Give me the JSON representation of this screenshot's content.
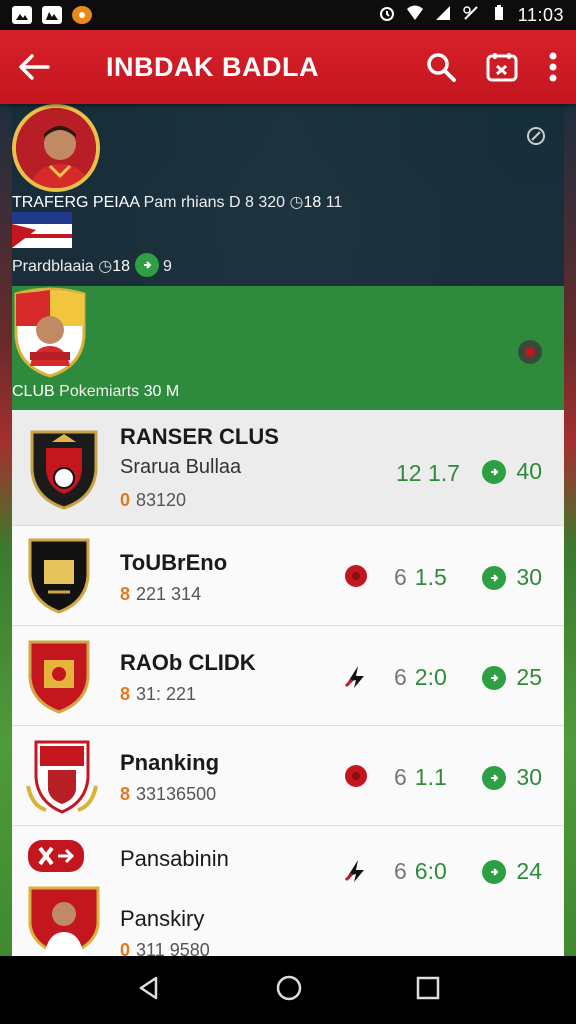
{
  "status_bar": {
    "time": "11:03",
    "left_icons": [
      "photo-icon",
      "image-icon",
      "notification-icon"
    ],
    "right_icons": [
      "alarm-icon",
      "wifi-icon",
      "signal-icon",
      "data-icon",
      "battery-icon"
    ]
  },
  "app_bar": {
    "title": "INBDAK BADLA",
    "back_icon": "back-arrow-icon",
    "actions": [
      "search-icon",
      "calendar-icon",
      "more-vert-icon"
    ]
  },
  "header_card": {
    "title": "TRAFERG PEIAA",
    "subtitle": "Pam rhians",
    "meta": "D 8 320",
    "score": "18",
    "right_value": "11",
    "second_line": {
      "name": "Prardblaaia",
      "score": "18",
      "right_value": "9"
    }
  },
  "highlight_card": {
    "title": "CLUB",
    "subtitle": "Pokemiarts",
    "score": "30 M"
  },
  "rows": [
    {
      "name": "RANSER CLUS",
      "sub": "Srarua Bullaa",
      "meta_num": "0",
      "meta": "83120",
      "score": "12 1.7",
      "right": "40"
    },
    {
      "name": "ToUBrEno",
      "sub": "",
      "meta_num": "8",
      "meta": "221 314",
      "score": "1.5",
      "right": "30"
    },
    {
      "name": "RAOb CLIDK",
      "sub": "",
      "meta_num": "8",
      "meta": "31: 221",
      "score": "2:0",
      "right": "25"
    },
    {
      "name": "Pnanking",
      "sub": "",
      "meta_num": "8",
      "meta": "33136500",
      "score": "1.1",
      "right": "30"
    },
    {
      "name": "Pansabinin",
      "sub": "",
      "meta_num": "",
      "meta": "",
      "score": "6:0",
      "right": "24"
    },
    {
      "name": "Panskiry",
      "sub": "",
      "meta_num": "0",
      "meta": "311 9580",
      "score": "",
      "right": ""
    }
  ],
  "score_prefix": "6",
  "colors": {
    "app_bar": "#d8202a",
    "highlight": "#2e8b3d",
    "accent_green": "#2ea043",
    "meta_orange": "#e07a20"
  }
}
